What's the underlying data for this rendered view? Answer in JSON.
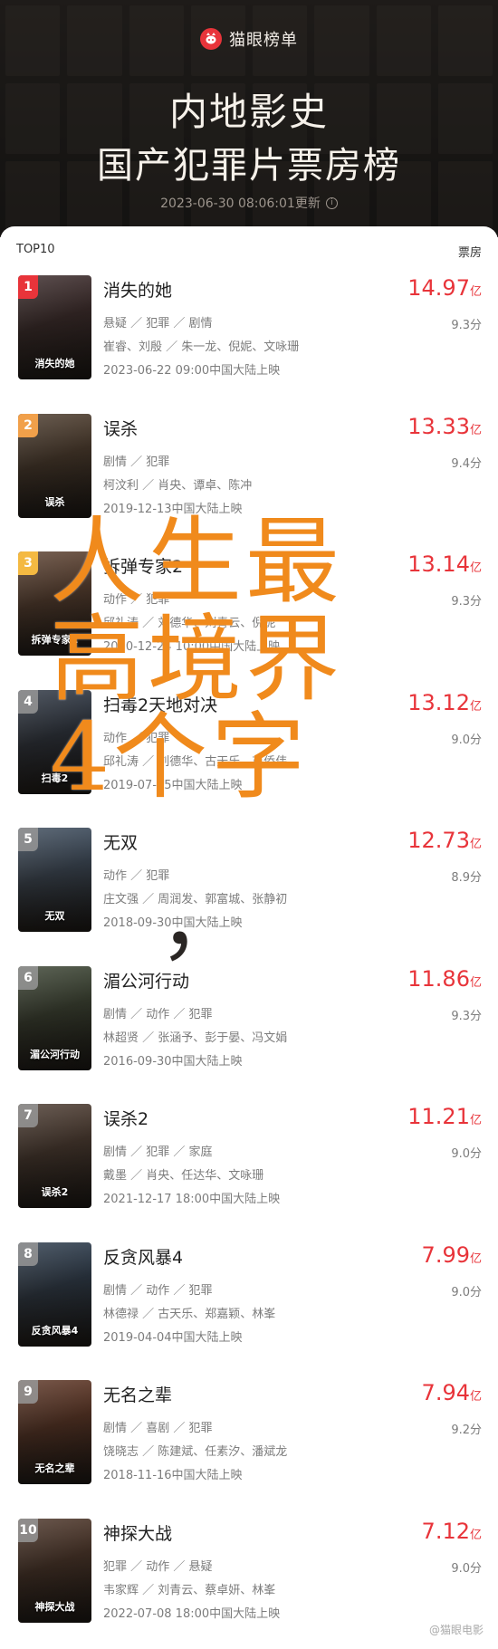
{
  "header": {
    "brand": "猫眼榜单",
    "title_line1": "内地影史",
    "title_line2": "国产犯罪片票房榜",
    "update_time": "2023-06-30 08:06:01更新"
  },
  "list": {
    "label_left": "TOP10",
    "label_right": "票房",
    "items": [
      {
        "rank": "1",
        "title": "消失的她",
        "genres": "悬疑 ／ 犯罪 ／ 剧情",
        "cast": "崔睿、刘殷 ／ 朱一龙、倪妮、文咏珊",
        "release": "2023-06-22 09:00中国大陆上映",
        "box_value": "14.97",
        "box_unit": "亿",
        "rating": "9.3分",
        "poster_color": "#3a2a2a",
        "poster_text": "消失的她"
      },
      {
        "rank": "2",
        "title": "误杀",
        "genres": "剧情 ／ 犯罪",
        "cast": "柯汶利 ／ 肖央、谭卓、陈冲",
        "release": "2019-12-13中国大陆上映",
        "box_value": "13.33",
        "box_unit": "亿",
        "rating": "9.4分",
        "poster_color": "#4a3a2c",
        "poster_text": "误杀"
      },
      {
        "rank": "3",
        "title": "拆弹专家2",
        "genres": "动作 ／ 犯罪",
        "cast": "邱礼涛 ／ 刘德华、刘青云、倪妮",
        "release": "2020-12-24 10:00中国大陆上映",
        "box_value": "13.14",
        "box_unit": "亿",
        "rating": "9.3分",
        "poster_color": "#5a4030",
        "poster_text": "拆弹专家2"
      },
      {
        "rank": "4",
        "title": "扫毒2天地对决",
        "genres": "动作 ／ 犯罪",
        "cast": "邱礼涛 ／ 刘德华、古天乐、苗侨伟",
        "release": "2019-07-05中国大陆上映",
        "box_value": "13.12",
        "box_unit": "亿",
        "rating": "9.0分",
        "poster_color": "#2c3440",
        "poster_text": "扫毒2"
      },
      {
        "rank": "5",
        "title": "无双",
        "genres": "动作 ／ 犯罪",
        "cast": "庄文强 ／ 周润发、郭富城、张静初",
        "release": "2018-09-30中国大陆上映",
        "box_value": "12.73",
        "box_unit": "亿",
        "rating": "8.9分",
        "poster_color": "#3c4a5a",
        "poster_text": "无双"
      },
      {
        "rank": "6",
        "title": "湄公河行动",
        "genres": "剧情 ／ 动作 ／ 犯罪",
        "cast": "林超贤 ／ 张涵予、彭于晏、冯文娟",
        "release": "2016-09-30中国大陆上映",
        "box_value": "11.86",
        "box_unit": "亿",
        "rating": "9.3分",
        "poster_color": "#3a4232",
        "poster_text": "湄公河行动"
      },
      {
        "rank": "7",
        "title": "误杀2",
        "genres": "剧情 ／ 犯罪 ／ 家庭",
        "cast": "戴墨 ／ 肖央、任达华、文咏珊",
        "release": "2021-12-17 18:00中国大陆上映",
        "box_value": "11.21",
        "box_unit": "亿",
        "rating": "9.0分",
        "poster_color": "#4a3a30",
        "poster_text": "误杀2"
      },
      {
        "rank": "8",
        "title": "反贪风暴4",
        "genres": "剧情 ／ 动作 ／ 犯罪",
        "cast": "林德禄 ／ 古天乐、郑嘉颖、林峯",
        "release": "2019-04-04中国大陆上映",
        "box_value": "7.99",
        "box_unit": "亿",
        "rating": "9.0分",
        "poster_color": "#2c3a4a",
        "poster_text": "反贪风暴4"
      },
      {
        "rank": "9",
        "title": "无名之辈",
        "genres": "剧情 ／ 喜剧 ／ 犯罪",
        "cast": "饶晓志 ／ 陈建斌、任素汐、潘斌龙",
        "release": "2018-11-16中国大陆上映",
        "box_value": "7.94",
        "box_unit": "亿",
        "rating": "9.2分",
        "poster_color": "#5a3424",
        "poster_text": "无名之辈"
      },
      {
        "rank": "10",
        "title": "神探大战",
        "genres": "犯罪 ／ 动作 ／ 悬疑",
        "cast": "韦家辉 ／ 刘青云、蔡卓妍、林峯",
        "release": "2022-07-08 18:00中国大陆上映",
        "box_value": "7.12",
        "box_unit": "亿",
        "rating": "9.0分",
        "poster_color": "#4a3428",
        "poster_text": "神探大战"
      }
    ]
  },
  "overlay": {
    "line1": "人生最",
    "line2": "高境界",
    "line3": "4个字",
    "comma": "，"
  },
  "watermark": "@猫眼电影"
}
